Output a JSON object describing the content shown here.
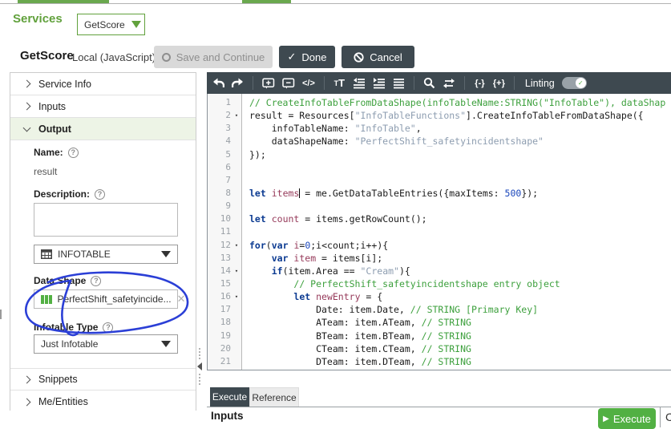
{
  "header": {
    "services_label": "Services",
    "service_selector_value": "GetScore",
    "title": "GetScore",
    "subtitle": "Local (JavaScript)",
    "save_button": "Save and Continue",
    "done_button": "Done",
    "cancel_button": "Cancel"
  },
  "sidebar": {
    "sections": [
      {
        "label": "Service Info",
        "expanded": false
      },
      {
        "label": "Inputs",
        "expanded": false
      },
      {
        "label": "Output",
        "expanded": true
      }
    ],
    "output_form": {
      "name_label": "Name:",
      "name_value": "result",
      "description_label": "Description:",
      "description_value": "",
      "base_type_value": "INFOTABLE",
      "data_shape_label": "Data Shape",
      "data_shape_value": "PerfectShift_safetyincide...",
      "infotable_type_label": "Infotable Type",
      "infotable_type_value": "Just Infotable"
    },
    "bottom_sections": [
      {
        "label": "Snippets"
      },
      {
        "label": "Me/Entities"
      }
    ]
  },
  "editor": {
    "toolbar": {
      "linting_label": "Linting",
      "linting_enabled": true,
      "code_icon_label": "</>",
      "brace_fold_label": "{-}",
      "brace_unfold_label": "{+}"
    },
    "lines": [
      {
        "n": 1,
        "fold": false,
        "t": [
          [
            "com",
            "// CreateInfoTableFromDataShape(infoTableName:STRING(\"InfoTable\"), dataShap"
          ]
        ]
      },
      {
        "n": 2,
        "fold": true,
        "t": [
          [
            "pl",
            "result = Resources["
          ],
          [
            "str",
            "\"InfoTableFunctions\""
          ],
          [
            "pl",
            "].CreateInfoTableFromDataShape({"
          ]
        ]
      },
      {
        "n": 3,
        "fold": false,
        "t": [
          [
            "pl",
            "    infoTableName: "
          ],
          [
            "str",
            "\"InfoTable\""
          ],
          [
            "pl",
            ","
          ]
        ]
      },
      {
        "n": 4,
        "fold": false,
        "t": [
          [
            "pl",
            "    dataShapeName: "
          ],
          [
            "str",
            "\"PerfectShift_safetyincidentshape\""
          ]
        ]
      },
      {
        "n": 5,
        "fold": false,
        "t": [
          [
            "pl",
            "});"
          ]
        ]
      },
      {
        "n": 6,
        "fold": false,
        "t": []
      },
      {
        "n": 7,
        "fold": false,
        "t": []
      },
      {
        "n": 8,
        "fold": false,
        "t": [
          [
            "kw",
            "let"
          ],
          [
            "pl",
            " "
          ],
          [
            "def",
            "items"
          ],
          [
            "caret",
            ""
          ],
          [
            "pl",
            " = me.GetDataTableEntries({maxItems: "
          ],
          [
            "num",
            "500"
          ],
          [
            "pl",
            "});"
          ]
        ]
      },
      {
        "n": 9,
        "fold": false,
        "t": []
      },
      {
        "n": 10,
        "fold": false,
        "t": [
          [
            "kw",
            "let"
          ],
          [
            "pl",
            " "
          ],
          [
            "def",
            "count"
          ],
          [
            "pl",
            " = items.getRowCount();"
          ]
        ]
      },
      {
        "n": 11,
        "fold": false,
        "t": []
      },
      {
        "n": 12,
        "fold": true,
        "t": [
          [
            "kw",
            "for"
          ],
          [
            "pl",
            "("
          ],
          [
            "kw",
            "var"
          ],
          [
            "pl",
            " "
          ],
          [
            "def",
            "i"
          ],
          [
            "pl",
            "="
          ],
          [
            "num",
            "0"
          ],
          [
            "pl",
            ";i<count;i++){"
          ]
        ]
      },
      {
        "n": 13,
        "fold": false,
        "t": [
          [
            "pl",
            "    "
          ],
          [
            "kw",
            "var"
          ],
          [
            "pl",
            " "
          ],
          [
            "def",
            "item"
          ],
          [
            "pl",
            " = items[i];"
          ]
        ]
      },
      {
        "n": 14,
        "fold": true,
        "t": [
          [
            "pl",
            "    "
          ],
          [
            "kw",
            "if"
          ],
          [
            "pl",
            "(item.Area == "
          ],
          [
            "str",
            "\"Cream\""
          ],
          [
            "pl",
            "){"
          ]
        ]
      },
      {
        "n": 15,
        "fold": false,
        "t": [
          [
            "pl",
            "        "
          ],
          [
            "com",
            "// PerfectShift_safetyincidentshape entry object"
          ]
        ]
      },
      {
        "n": 16,
        "fold": true,
        "t": [
          [
            "pl",
            "        "
          ],
          [
            "kw",
            "let"
          ],
          [
            "pl",
            " "
          ],
          [
            "def",
            "newEntry"
          ],
          [
            "pl",
            " = {"
          ]
        ]
      },
      {
        "n": 17,
        "fold": false,
        "t": [
          [
            "pl",
            "            Date: item.Date, "
          ],
          [
            "com",
            "// STRING [Primary Key]"
          ]
        ]
      },
      {
        "n": 18,
        "fold": false,
        "t": [
          [
            "pl",
            "            ATeam: item.ATeam, "
          ],
          [
            "com",
            "// STRING"
          ]
        ]
      },
      {
        "n": 19,
        "fold": false,
        "t": [
          [
            "pl",
            "            BTeam: item.BTeam, "
          ],
          [
            "com",
            "// STRING"
          ]
        ]
      },
      {
        "n": 20,
        "fold": false,
        "t": [
          [
            "pl",
            "            CTeam: item.CTeam, "
          ],
          [
            "com",
            "// STRING"
          ]
        ]
      },
      {
        "n": 21,
        "fold": false,
        "t": [
          [
            "pl",
            "            DTeam: item.DTeam, "
          ],
          [
            "com",
            "// STRING"
          ]
        ]
      }
    ]
  },
  "bottom_panel": {
    "tabs": [
      {
        "label": "Execute",
        "active": true
      },
      {
        "label": "Reference",
        "active": false
      }
    ],
    "inputs_heading": "Inputs",
    "execute_button": "Execute",
    "clipped_right_text": "C"
  },
  "colors": {
    "brand_green": "#61a13c",
    "execute_green": "#52b043",
    "dark_slate": "#3e4950",
    "annotation_blue": "#2b3fd6",
    "code_comment": "#3da03d",
    "code_string": "#8d9db0",
    "code_keyword": "#0b3a91",
    "code_variable_def": "#963a5a",
    "code_number": "#1a46bb"
  }
}
